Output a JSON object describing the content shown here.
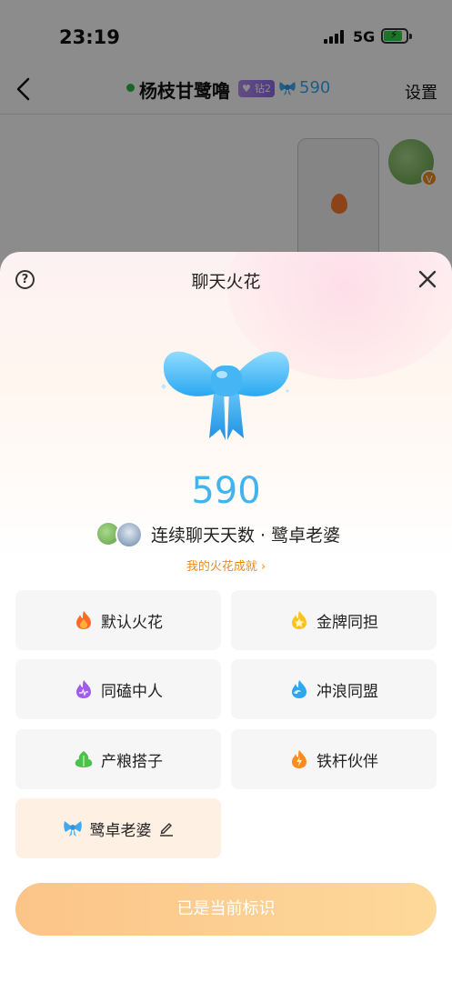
{
  "status_bar": {
    "time": "23:19",
    "network": "5G"
  },
  "nav": {
    "title": "杨枝甘鹭噜",
    "level_badge": "钻2",
    "fire_count": "590",
    "settings_label": "设置"
  },
  "sheet": {
    "title": "聊天火花",
    "fire_count": "590",
    "streak_text": "连续聊天天数 · 鹭卓老婆",
    "achievement_link": "我的火花成就 ›"
  },
  "options": [
    {
      "label": "默认火花",
      "icon": "flame-orange-icon"
    },
    {
      "label": "金牌同担",
      "icon": "star-gold-icon"
    },
    {
      "label": "同磕中人",
      "icon": "flame-purple-icon"
    },
    {
      "label": "冲浪同盟",
      "icon": "wave-blue-icon"
    },
    {
      "label": "产粮搭子",
      "icon": "leaf-green-icon"
    },
    {
      "label": "铁杆伙伴",
      "icon": "lightning-orange-icon"
    },
    {
      "label": "鹭卓老婆",
      "icon": "bow-blue-icon",
      "selected": true
    }
  ],
  "primary_button": {
    "label": "已是当前标识"
  },
  "colors": {
    "accent_blue": "#3fb4f0",
    "accent_orange": "#f08a18",
    "button_gradient_start": "#fcc488",
    "button_gradient_end": "#fdd99a"
  }
}
